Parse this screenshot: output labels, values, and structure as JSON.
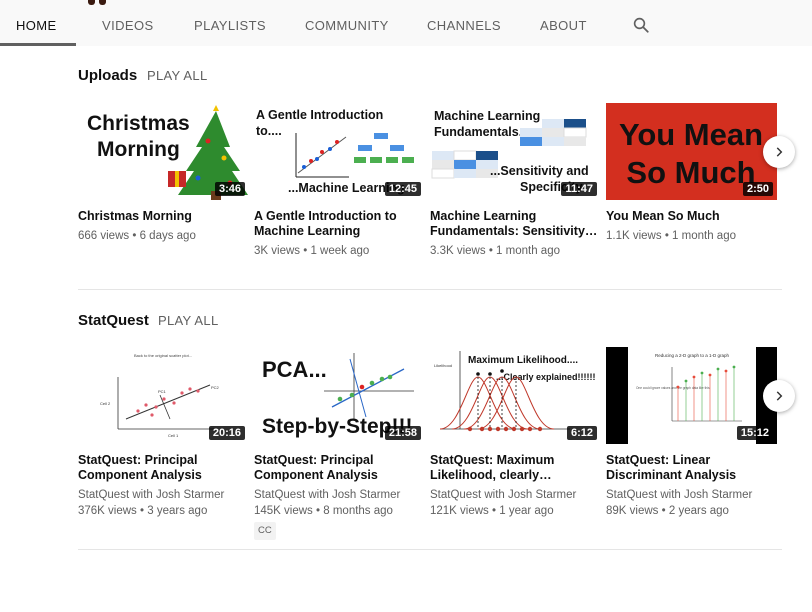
{
  "tabs": [
    {
      "label": "HOME",
      "active": true
    },
    {
      "label": "VIDEOS",
      "active": false
    },
    {
      "label": "PLAYLISTS",
      "active": false
    },
    {
      "label": "COMMUNITY",
      "active": false
    },
    {
      "label": "CHANNELS",
      "active": false
    },
    {
      "label": "ABOUT",
      "active": false
    }
  ],
  "sections": [
    {
      "title": "Uploads",
      "play_all": "PLAY ALL",
      "videos": [
        {
          "title": "Christmas Morning",
          "views": "666 views",
          "age": "6 days ago",
          "duration": "3:46",
          "thumb_lines": [
            "Christmas",
            "Morning"
          ]
        },
        {
          "title": "A Gentle Introduction to Machine Learning",
          "title_display": "A Gentle Introduction to\nMachine Learning",
          "views": "3K views",
          "age": "1 week ago",
          "duration": "12:45",
          "thumb_lines": [
            "A Gentle Introduction",
            "to....",
            "...Machine Learning"
          ]
        },
        {
          "title": "Machine Learning Fundamentals: Sensitivity…",
          "views": "3.3K views",
          "age": "1 month ago",
          "duration": "11:47",
          "thumb_lines": [
            "Machine Learning",
            "Fundamentals....",
            "...Sensitivity and",
            "Specificity"
          ]
        },
        {
          "title": "You Mean So Much",
          "views": "1.1K views",
          "age": "1 month ago",
          "duration": "2:50",
          "thumb_lines": [
            "You Mean",
            "So Much"
          ]
        }
      ]
    },
    {
      "title": "StatQuest",
      "play_all": "PLAY ALL",
      "videos": [
        {
          "title": "StatQuest: Principal Component Analysis (PCA)…",
          "channel": "StatQuest with Josh Starmer",
          "views": "376K views",
          "age": "3 years ago",
          "duration": "20:16",
          "thumb_lines": [
            "Back to the original scatter plot...",
            "PC1",
            "PC2",
            "Cell 1",
            "Cell 2"
          ]
        },
        {
          "title": "StatQuest: Principal Component Analysis (PCA),…",
          "channel": "StatQuest with Josh Starmer",
          "views": "145K views",
          "age": "8 months ago",
          "duration": "21:58",
          "badge": "CC",
          "thumb_lines": [
            "PCA...",
            "Step-by-Step!!!"
          ]
        },
        {
          "title": "StatQuest: Maximum Likelihood, clearly…",
          "channel": "StatQuest with Josh Starmer",
          "views": "121K views",
          "age": "1 year ago",
          "duration": "6:12",
          "thumb_lines": [
            "Maximum Likelihood....",
            "...Clearly explained!!!!!!",
            "Likelihood"
          ]
        },
        {
          "title": "StatQuest: Linear Discriminant Analysis (LDA…",
          "channel": "StatQuest with Josh Starmer",
          "views": "89K views",
          "age": "2 years ago",
          "duration": "15:12",
          "thumb_lines": [
            "Reducing a 2-D graph to a 1-D graph",
            "One could ignore values and the graph data like this"
          ]
        }
      ]
    }
  ],
  "meta_separator": "•",
  "icons": {
    "search": "search-icon",
    "next": "chevron-right-icon"
  }
}
